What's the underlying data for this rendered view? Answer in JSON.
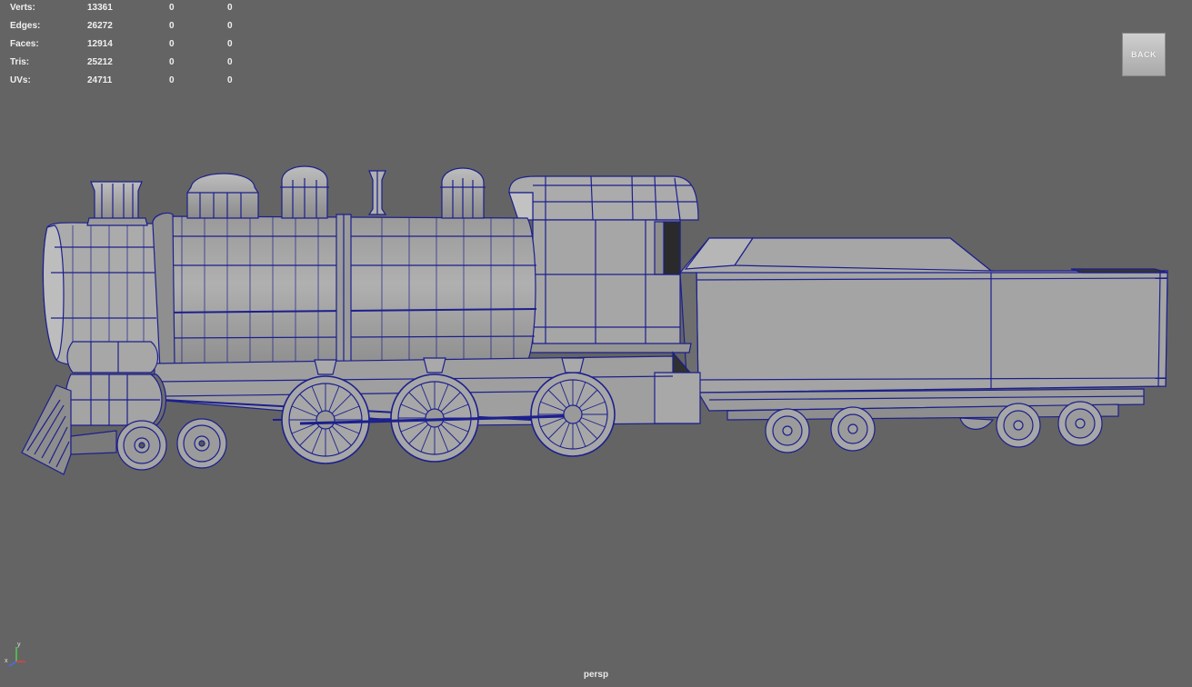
{
  "hud": {
    "rows": [
      {
        "label": "Verts:",
        "v1": "13361",
        "v2": "0",
        "v3": "0"
      },
      {
        "label": "Edges:",
        "v1": "26272",
        "v2": "0",
        "v3": "0"
      },
      {
        "label": "Faces:",
        "v1": "12914",
        "v2": "0",
        "v3": "0"
      },
      {
        "label": "Tris:",
        "v1": "25212",
        "v2": "0",
        "v3": "0"
      },
      {
        "label": "UVs:",
        "v1": "24711",
        "v2": "0",
        "v3": "0"
      }
    ]
  },
  "view_cube": {
    "label": "BACK"
  },
  "camera": {
    "name": "persp"
  },
  "axis_gizmo": {
    "y_label": "y",
    "x_label": "x"
  },
  "colors": {
    "viewport_bg": "#646464",
    "model_fill": "#a2a2a2",
    "wireframe": "#1c1f8c",
    "hud_text": "#f0f0f0"
  }
}
